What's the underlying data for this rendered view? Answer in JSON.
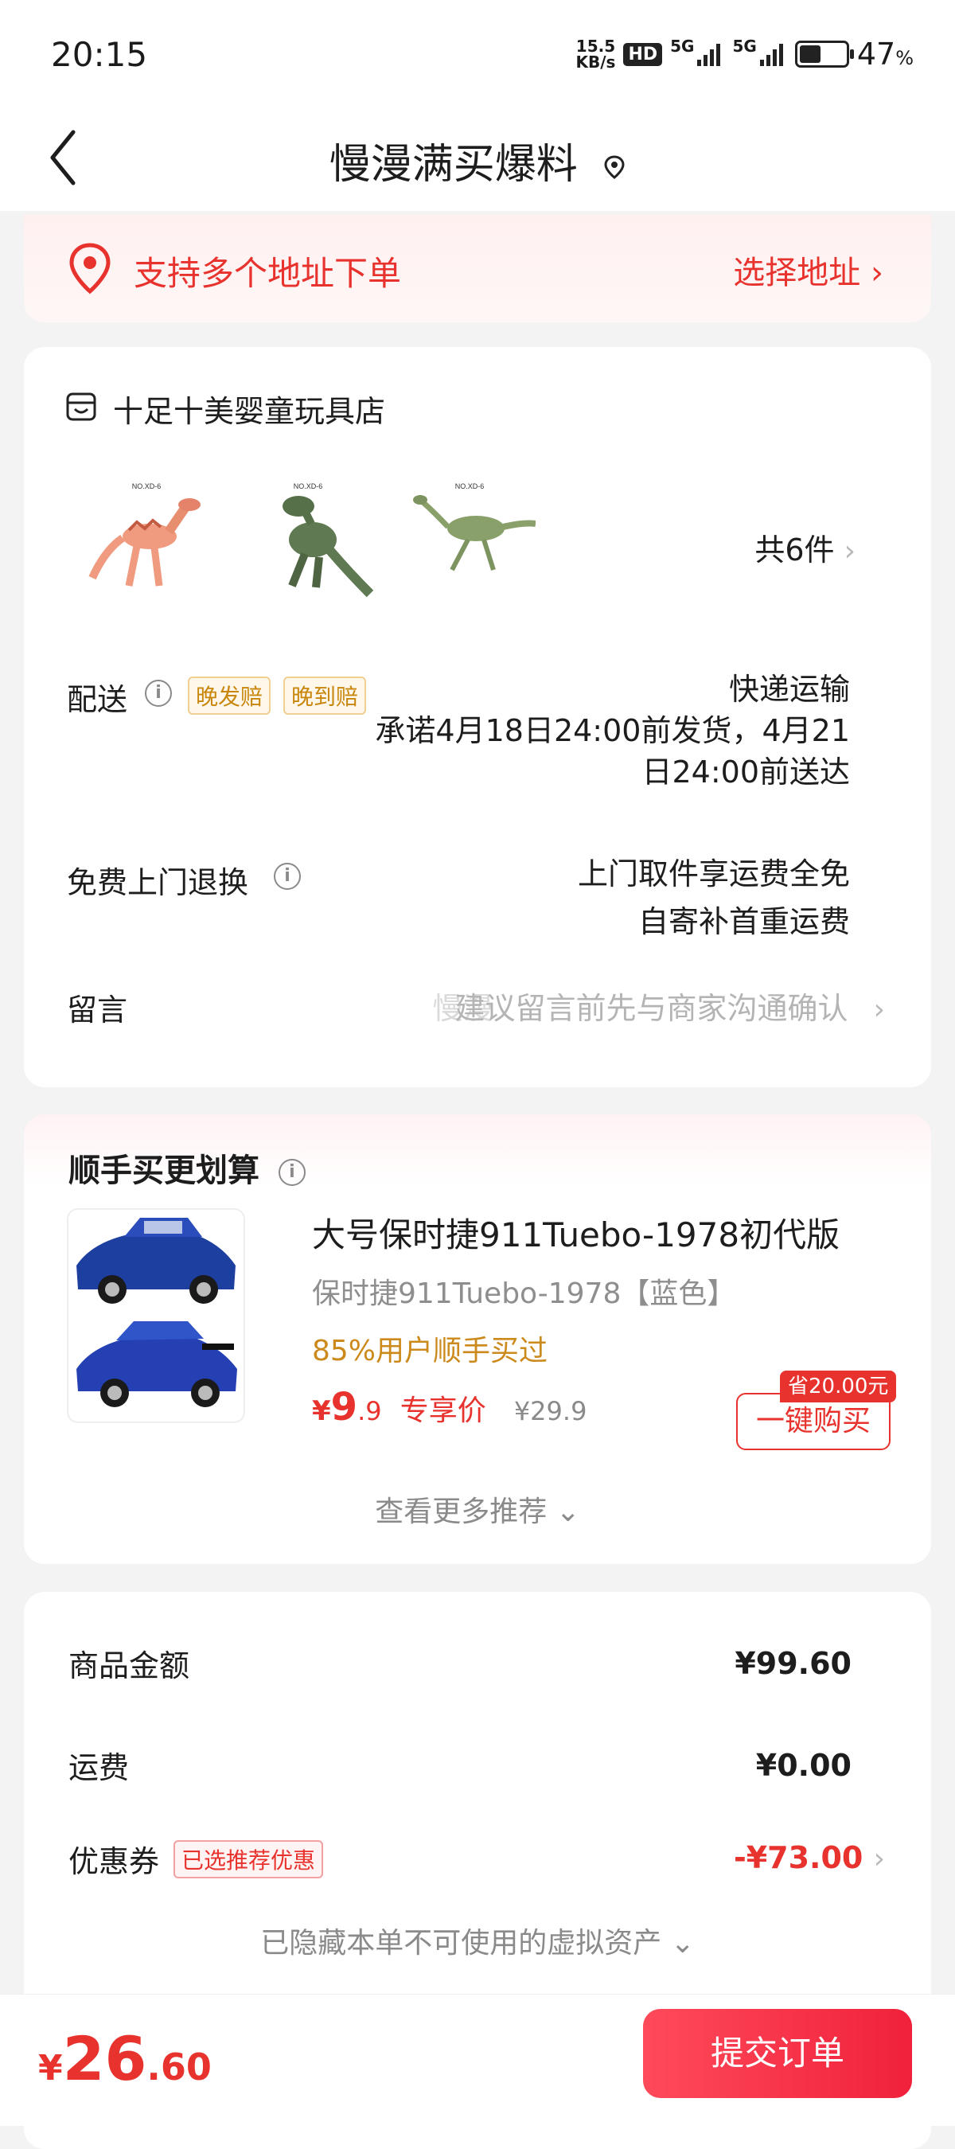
{
  "status_bar": {
    "time": "20:15",
    "speed_value": "15.5",
    "speed_unit": "KB/s",
    "hd": "HD",
    "net1": "5G",
    "net2": "5G",
    "battery": "47",
    "battery_unit": "%",
    "battery_level": 0.47
  },
  "nav": {
    "title": "慢漫满买爆料"
  },
  "address": {
    "text": "支持多个地址下单",
    "link": "选择地址 ›"
  },
  "store": {
    "name": "十足十美婴童玩具店",
    "count": "共6件",
    "delivery_label": "配送",
    "tags": [
      "晚发赔",
      "晚到赔"
    ],
    "delivery_method": "快递运输",
    "delivery_promise_1": "承诺4月18日24:00前发货，4月21",
    "delivery_promise_2": "日24:00前送达",
    "returns_label": "免费上门退换",
    "returns_line1": "上门取件享运费全免",
    "returns_line2": "自寄补首重运费",
    "message_label": "留言",
    "message_hint_overlay": "慢漫",
    "message_placeholder": "建议留言前先与商家沟通确认"
  },
  "recommend": {
    "title": "顺手买更划算",
    "product_name": "大号保时捷911Tuebo-1978初代版",
    "variant": "保时捷911Tuebo-1978【蓝色】",
    "percent": "85%用户顺手买过",
    "price_symbol": "¥",
    "price_int": "9",
    "price_dec": ".9",
    "price_tag": "专享价",
    "orig_price": "¥29.9",
    "save_badge": "省20.00元",
    "buy_button": "一键购买",
    "more": "查看更多推荐 ⌄"
  },
  "summary": {
    "goods_label": "商品金额",
    "goods_value": "¥99.60",
    "shipping_label": "运费",
    "shipping_value": "¥0.00",
    "coupon_label": "优惠券",
    "coupon_tag": "已选推荐优惠",
    "coupon_value": "-¥73.00",
    "hidden_assets": "已隐藏本单不可使用的虚拟资产 ⌄"
  },
  "bottom": {
    "currency": "¥",
    "total_int": "26",
    "total_dec": ".60",
    "submit": "提交订单"
  },
  "colors": {
    "accent": "#e8322d",
    "tag_gold": "#c8860c",
    "bg": "#f3f3f3"
  },
  "icons": [
    "back-arrow-icon",
    "location-pin-icon",
    "store-icon",
    "info-icon",
    "chevron-right-icon"
  ]
}
